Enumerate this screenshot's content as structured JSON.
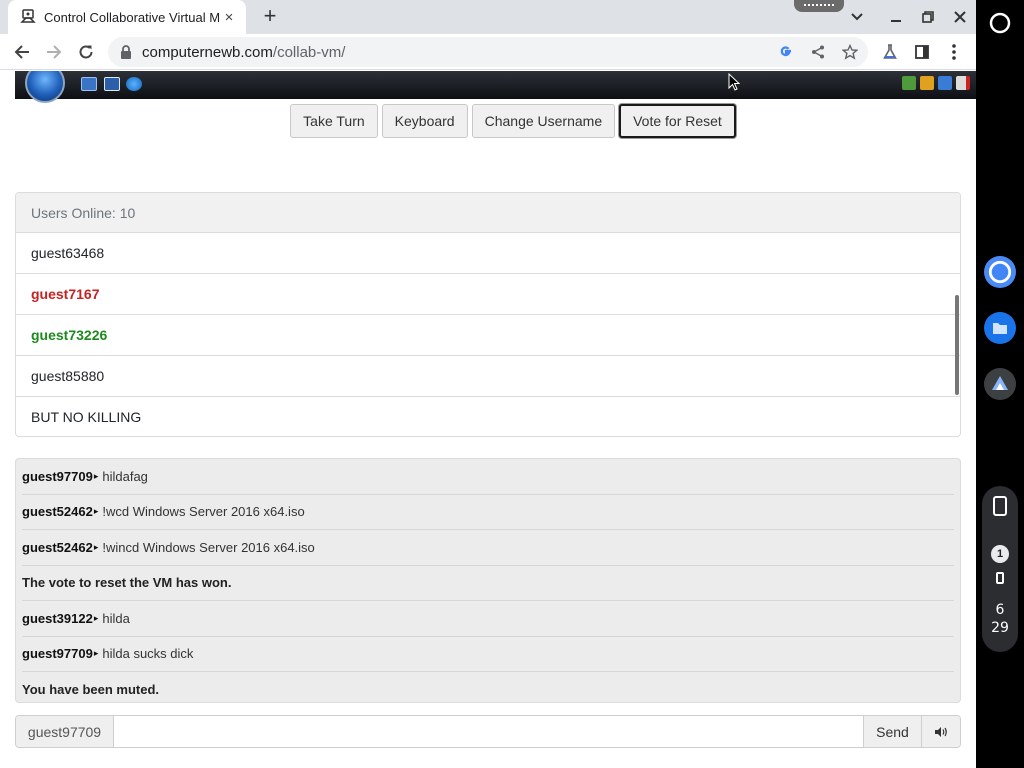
{
  "browser": {
    "tab_title": "Control Collaborative Virtual Machines!",
    "new_tab_symbol": "+",
    "close_tab_symbol": "×",
    "url_host": "computernewb.com",
    "url_path": "/collab-vm/"
  },
  "vm_controls": {
    "buttons": [
      {
        "label": "Take Turn"
      },
      {
        "label": "Keyboard"
      },
      {
        "label": "Change Username"
      },
      {
        "label": "Vote for Reset"
      }
    ]
  },
  "users": {
    "header": "Users Online: 10",
    "list": [
      {
        "name": "guest63468",
        "style": "normal"
      },
      {
        "name": "guest7167",
        "style": "red"
      },
      {
        "name": "guest73226",
        "style": "green"
      },
      {
        "name": "guest85880",
        "style": "normal"
      },
      {
        "name": "BUT NO KILLING",
        "style": "normal"
      }
    ]
  },
  "chat": {
    "separator": "▸",
    "messages": [
      {
        "user": "guest97709",
        "text": "hildafag"
      },
      {
        "user": "guest52462",
        "text": "!wcd Windows Server 2016 x64.iso"
      },
      {
        "user": "guest52462",
        "text": "!wincd Windows Server 2016 x64.iso"
      },
      {
        "system": "The vote to reset the VM has won."
      },
      {
        "user": "guest39122",
        "text": "hilda"
      },
      {
        "user": "guest97709",
        "text": "hilda sucks dick"
      },
      {
        "system": "You have been muted."
      }
    ]
  },
  "chat_input": {
    "username": "guest97709",
    "value": "",
    "send_label": "Send",
    "voice_icon": "speaker-icon"
  },
  "shelf": {
    "notification_count": "1",
    "clock_hour": "6",
    "clock_minute": "29"
  },
  "colors": {
    "user_red": "#c82121",
    "user_green": "#1d8a1d",
    "chrome_bg": "#dee1e6"
  }
}
